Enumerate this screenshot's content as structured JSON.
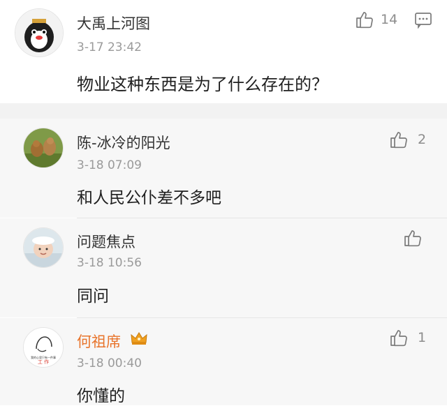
{
  "main_post": {
    "username": "大禹上河图",
    "time": "3-17 23:42",
    "content": "物业这种东西是为了什么存在的？",
    "likes": "14",
    "like_icon": "thumbs-up-icon",
    "comment_icon": "comment-icon",
    "avatar_icon": "penguin-avatar"
  },
  "replies": [
    {
      "username": "陈-冰冷的阳光",
      "time": "3-18 07:09",
      "content": "和人民公仆差不多吧",
      "likes": "2",
      "avatar_icon": "squirrels-avatar"
    },
    {
      "username": "问题焦点",
      "time": "3-18 10:56",
      "content": "同问",
      "likes": "",
      "avatar_icon": "baby-avatar"
    },
    {
      "username": "何祖席",
      "time": "3-18 00:40",
      "content": "你懂的",
      "likes": "1",
      "vip": true,
      "avatar_icon": "work-meme-avatar",
      "avatar_text": "我的心里只有一件事 就是 工作",
      "badge_icon": "crown-icon"
    }
  ],
  "colors": {
    "vip_name": "#e8742b",
    "crown": "#f0a020",
    "separator": "#f2f2f2",
    "reply_bg": "#f7f7f7"
  }
}
